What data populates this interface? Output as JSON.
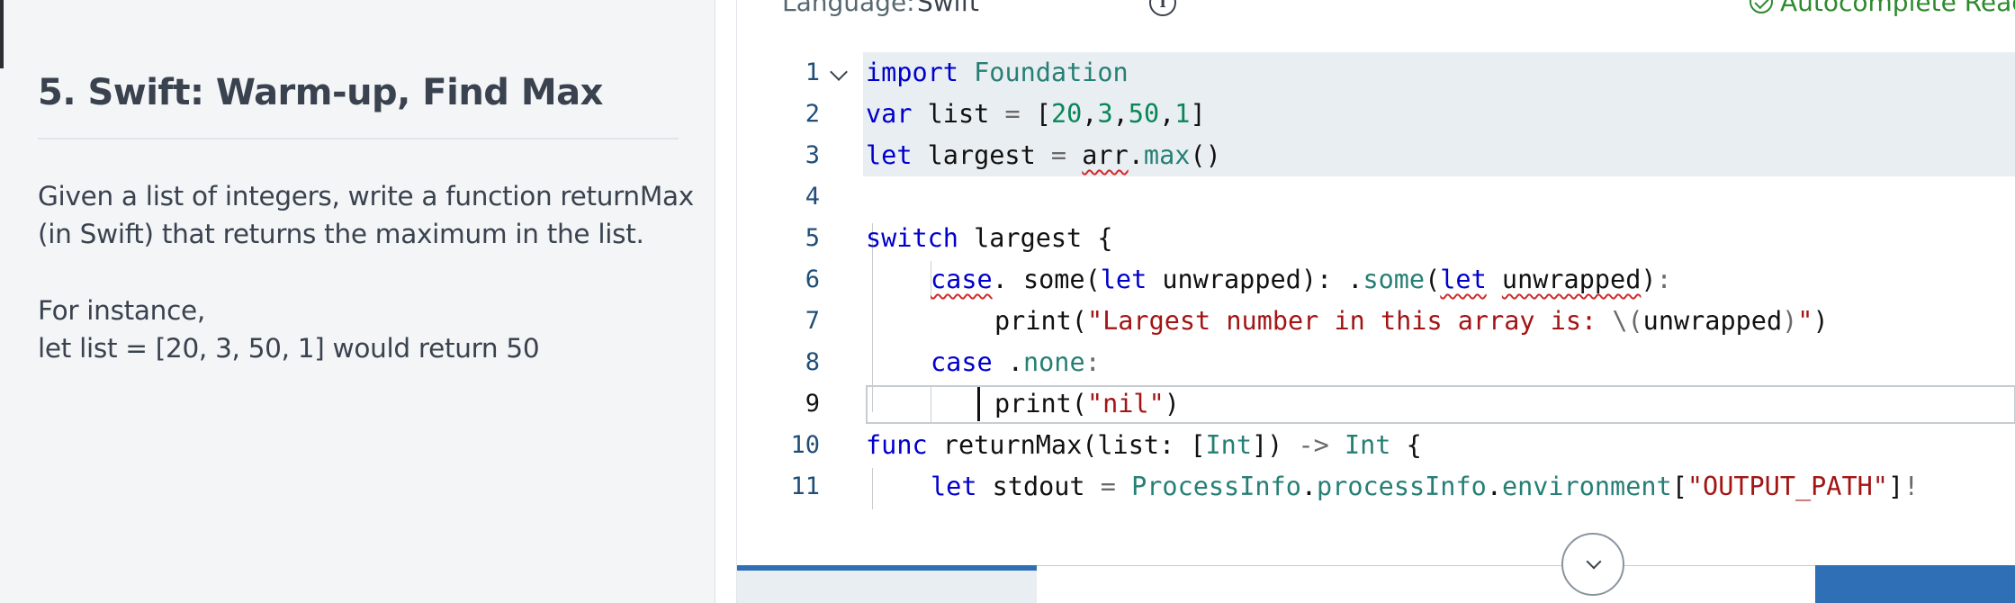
{
  "problem": {
    "title": "5. Swift: Warm-up, Find Max",
    "description_line1": "Given a list of integers, write a function returnMax",
    "description_line2": "(in Swift) that returns the maximum in the list.",
    "example_line1": "For instance,",
    "example_line2": "let list = [20, 3, 50, 1] would return 50"
  },
  "editor": {
    "language_label": "Language:",
    "language_value": "Swift",
    "info_icon": "info-icon",
    "autocomplete_status": "Autocomplete Ready",
    "status_color": "#2d8a2d",
    "active_line": 9,
    "lines": [
      {
        "number": "1"
      },
      {
        "number": "2"
      },
      {
        "number": "3"
      },
      {
        "number": "4"
      },
      {
        "number": "5"
      },
      {
        "number": "6"
      },
      {
        "number": "7"
      },
      {
        "number": "8"
      },
      {
        "number": "9"
      },
      {
        "number": "10"
      },
      {
        "number": "11"
      }
    ],
    "code": {
      "l1": [
        "import",
        " ",
        "Foundation"
      ],
      "l2": [
        "var",
        " list ",
        "=",
        " [",
        "20",
        ",",
        "3",
        ",",
        "50",
        ",",
        "1",
        "]"
      ],
      "l3": [
        "let",
        " largest ",
        "=",
        " ",
        "arr",
        ".",
        "max",
        "()"
      ],
      "l5": [
        "switch",
        " largest {"
      ],
      "l6": [
        "case",
        ". some(",
        "let",
        " unwrapped): .",
        "some",
        "(",
        "let",
        " ",
        "unwrapped",
        ")",
        ":"
      ],
      "l7": [
        "print(",
        "\"Largest number in this array is: ",
        "\\(",
        "unwrapped",
        ")",
        "\"",
        ")"
      ],
      "l8": [
        "case",
        " .",
        "none",
        ":"
      ],
      "l9": [
        "print(",
        "\"nil\"",
        ")"
      ],
      "l10": [
        "func",
        " returnMax(list: [",
        "Int",
        "]) ",
        "->",
        " ",
        "Int",
        " {"
      ],
      "l11": [
        "let",
        " stdout ",
        "=",
        " ",
        "ProcessInfo",
        ".",
        "processInfo",
        ".",
        "environment",
        "[",
        "\"OUTPUT_PATH\"",
        "]",
        "!"
      ]
    }
  }
}
